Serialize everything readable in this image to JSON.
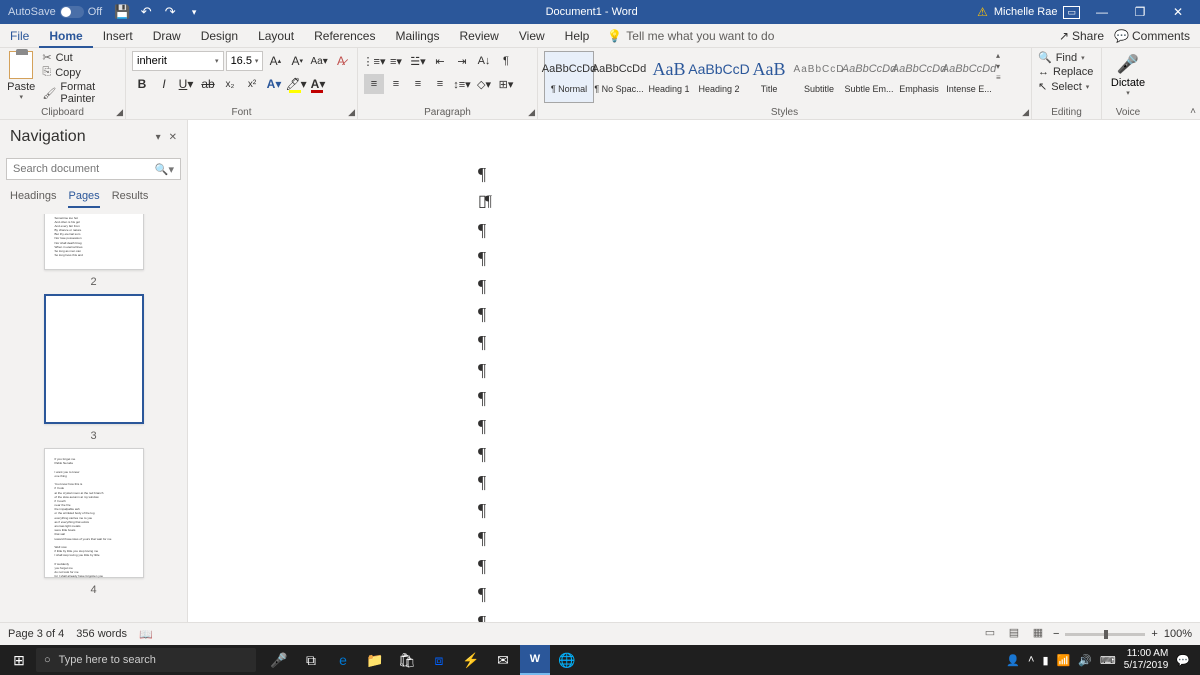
{
  "titlebar": {
    "autosave_label": "AutoSave",
    "autosave_state": "Off",
    "doc_title": "Document1 - Word",
    "user_name": "Michelle Rae"
  },
  "tabs": {
    "file": "File",
    "home": "Home",
    "insert": "Insert",
    "draw": "Draw",
    "design": "Design",
    "layout": "Layout",
    "references": "References",
    "mailings": "Mailings",
    "review": "Review",
    "view": "View",
    "help": "Help",
    "tell_me": "Tell me what you want to do",
    "share": "Share",
    "comments": "Comments"
  },
  "ribbon": {
    "clipboard": {
      "label": "Clipboard",
      "paste": "Paste",
      "cut": "Cut",
      "copy": "Copy",
      "format_painter": "Format Painter"
    },
    "font": {
      "label": "Font",
      "font_name": "inherit",
      "font_size": "16.5"
    },
    "paragraph": {
      "label": "Paragraph"
    },
    "styles": {
      "label": "Styles",
      "items": [
        {
          "preview": "AaBbCcDd",
          "name": "¶ Normal",
          "cls": ""
        },
        {
          "preview": "AaBbCcDd",
          "name": "¶ No Spac...",
          "cls": ""
        },
        {
          "preview": "AaB",
          "name": "Heading 1",
          "cls": "big"
        },
        {
          "preview": "AaBbCcD",
          "name": "Heading 2",
          "cls": "h1"
        },
        {
          "preview": "AaB",
          "name": "Title",
          "cls": "big"
        },
        {
          "preview": "AaBbCcD",
          "name": "Subtitle",
          "cls": "sub"
        },
        {
          "preview": "AaBbCcDd",
          "name": "Subtle Em...",
          "cls": "em"
        },
        {
          "preview": "AaBbCcDd",
          "name": "Emphasis",
          "cls": "em"
        },
        {
          "preview": "AaBbCcDd",
          "name": "Intense E...",
          "cls": "em"
        }
      ]
    },
    "editing": {
      "label": "Editing",
      "find": "Find",
      "replace": "Replace",
      "select": "Select"
    },
    "voice": {
      "label": "Voice",
      "dictate": "Dictate"
    }
  },
  "nav": {
    "title": "Navigation",
    "search_placeholder": "Search document",
    "tabs": {
      "headings": "Headings",
      "pages": "Pages",
      "results": "Results"
    },
    "page_labels": [
      "2",
      "3",
      "4"
    ]
  },
  "statusbar": {
    "page": "Page 3 of 4",
    "words": "356 words",
    "zoom": "100%"
  },
  "taskbar": {
    "search_placeholder": "Type here to search",
    "time": "11:00 AM",
    "date": "5/17/2019"
  }
}
